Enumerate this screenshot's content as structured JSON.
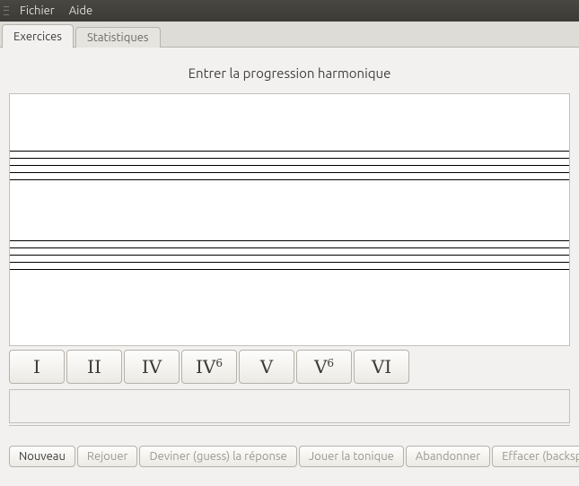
{
  "menu": {
    "file": "Fichier",
    "help": "Aide"
  },
  "tabs": {
    "exercises": "Exercices",
    "stats": "Statistiques"
  },
  "title": "Entrer la progression harmonique",
  "chords": {
    "c0": "I",
    "c1": "II",
    "c2": "IV",
    "c3_base": "IV",
    "c3_sup": "6",
    "c4": "V",
    "c5_base": "V",
    "c5_sup": "6",
    "c6": "VI"
  },
  "actions": {
    "new": "Nouveau",
    "replay": "Rejouer",
    "guess": "Deviner (guess) la réponse",
    "tonic": "Jouer la tonique",
    "giveup": "Abandonner",
    "erase": "Effacer (backspace)"
  }
}
